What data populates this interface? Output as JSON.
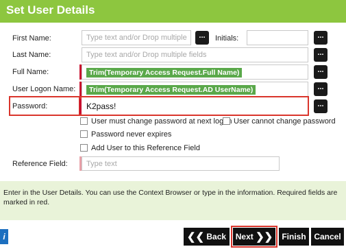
{
  "header": {
    "title": "Set User Details"
  },
  "fields": {
    "first_name": {
      "label": "First Name:",
      "placeholder": "Type text and/or Drop multiple fie"
    },
    "initials": {
      "label": "Initials:",
      "value": ""
    },
    "last_name": {
      "label": "Last Name:",
      "placeholder": "Type text and/or Drop multiple fields"
    },
    "full_name": {
      "label": "Full Name:",
      "token": "Trim(Temporary Access Request.Full Name)"
    },
    "user_logon_name": {
      "label": "User Logon Name:",
      "token": "Trim(Temporary Access Request.AD UserName)"
    },
    "password": {
      "label": "Password:",
      "value": "K2pass!"
    },
    "reference_field": {
      "label": "Reference Field:",
      "placeholder": "Type text"
    }
  },
  "browse_button_label": "...",
  "checkboxes": [
    {
      "label": "User must change password at next logon",
      "checked": false
    },
    {
      "label": "User cannot change password",
      "checked": false
    },
    {
      "label": "Password never expires",
      "checked": false
    },
    {
      "label": "Add User to this Reference Field",
      "checked": false
    }
  ],
  "help": {
    "text": "Enter in the User Details. You can use the Context Browser or type in the information. Required fields are marked in red."
  },
  "footer": {
    "info_label": "i",
    "back_label": "Back",
    "next_label": "Next",
    "finish_label": "Finish",
    "cancel_label": "Cancel"
  },
  "colors": {
    "header_bg": "#8dc63f",
    "token_bg": "#5aa84a",
    "required_marker": "#c8102e",
    "highlight_box": "#d9342b",
    "help_bg": "#e9f3d9"
  }
}
